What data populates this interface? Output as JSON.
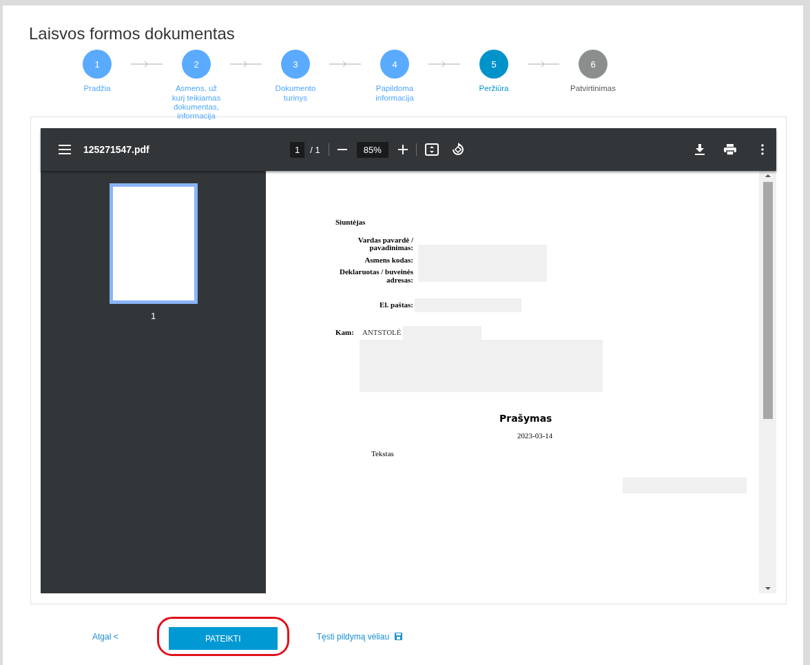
{
  "page": {
    "title": "Laisvos formos dokumentas"
  },
  "steps": [
    {
      "number": "1",
      "label": "Pradžia",
      "completed": true,
      "selected": false
    },
    {
      "number": "2",
      "label": "Asmens, už kurį teikiamas dokumentas, informacija",
      "completed": true,
      "selected": false
    },
    {
      "number": "3",
      "label": "Dokumento turinys",
      "completed": true,
      "selected": false
    },
    {
      "number": "4",
      "label": "Papildoma informacija",
      "completed": true,
      "selected": false
    },
    {
      "number": "5",
      "label": "Peržiūra",
      "completed": false,
      "selected": true
    },
    {
      "number": "6",
      "label": "Patvirtinimas",
      "completed": false,
      "selected": false
    }
  ],
  "viewer": {
    "file_name": "125271547.pdf",
    "page_input": "1",
    "page_total": "/ 1",
    "zoom": "85%",
    "thumbnails": [
      {
        "page": "1",
        "selected": true
      }
    ]
  },
  "document": {
    "sender_heading": "Siuntėjas",
    "sender_fields": [
      "Vardas pavardė / pavadinimas:",
      "Asmens kodas:",
      "Deklaruotas / buveinės adresas:"
    ],
    "email_label": "El. paštas:",
    "to_label": "Kam:",
    "recipient": "ANTSTOLĖ",
    "heading": "Prašymas",
    "date": "2023-03-14",
    "body": "Tekstas"
  },
  "actions": {
    "back": "Atgal <",
    "submit": {
      "label": "PATEIKTI",
      "highlighted": true
    },
    "save_later": "Tęsti pildymą vėliau"
  }
}
